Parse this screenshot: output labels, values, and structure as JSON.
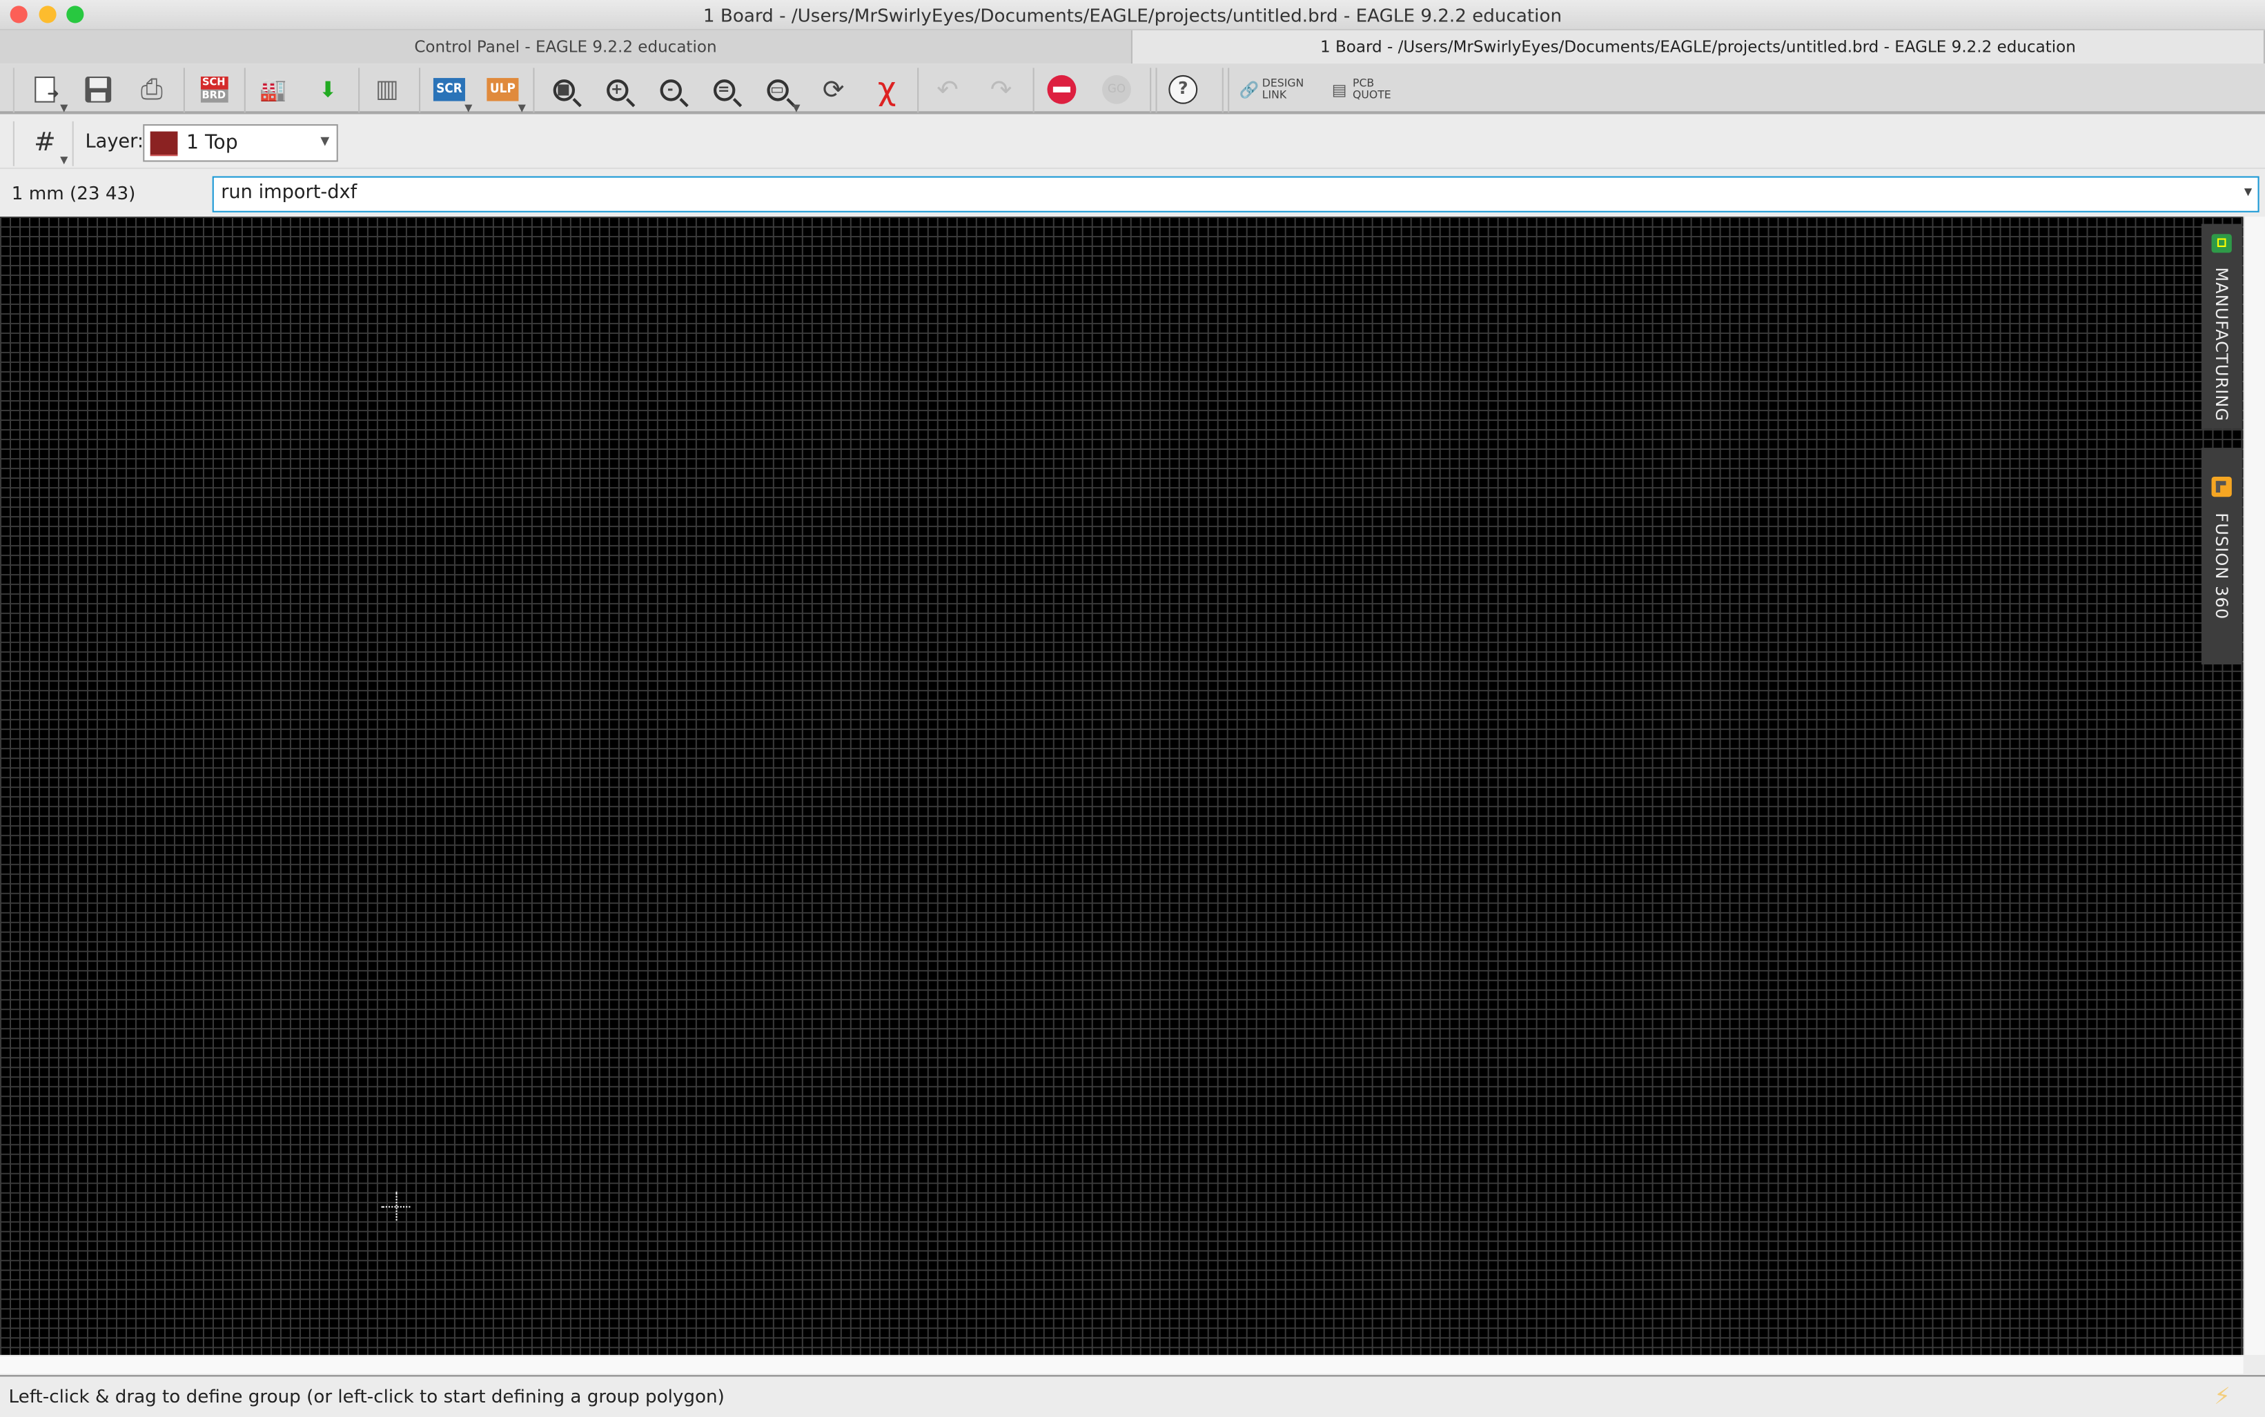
{
  "window": {
    "title": "1 Board - /Users/MrSwirlyEyes/Documents/EAGLE/projects/untitled.brd - EAGLE 9.2.2 education"
  },
  "tabs": [
    {
      "label": "Control Panel - EAGLE 9.2.2 education",
      "active": false
    },
    {
      "label": "1 Board - /Users/MrSwirlyEyes/Documents/EAGLE/projects/untitled.brd - EAGLE 9.2.2 education",
      "active": true
    }
  ],
  "toolbar": {
    "sch_label_top": "SCH",
    "sch_label_bottom": "BRD",
    "scr_label": "SCR",
    "ulp_label": "ULP",
    "go_label": "GO",
    "help_label": "?",
    "design_link": [
      "DESIGN",
      "LINK"
    ],
    "pcb_quote": [
      "PCB",
      "QUOTE"
    ]
  },
  "layerbar": {
    "label": "Layer:",
    "selected_layer": "1 Top",
    "layer_color": "#8b2222"
  },
  "command": {
    "grid_readout": "1 mm (23 43)",
    "input_value": "run import-dxf"
  },
  "side_panels": [
    {
      "label": "MANUFACTURING"
    },
    {
      "label": "FUSION 360"
    }
  ],
  "status": {
    "message": "Left-click & drag to define group (or left-click to start defining a group polygon)"
  },
  "colors": {
    "accent": "#1a98d5",
    "stop": "#dd2040",
    "scr": "#2a73b8",
    "ulp": "#e08a3c",
    "canvas": "#000000",
    "grid": "#3a3a3a"
  }
}
